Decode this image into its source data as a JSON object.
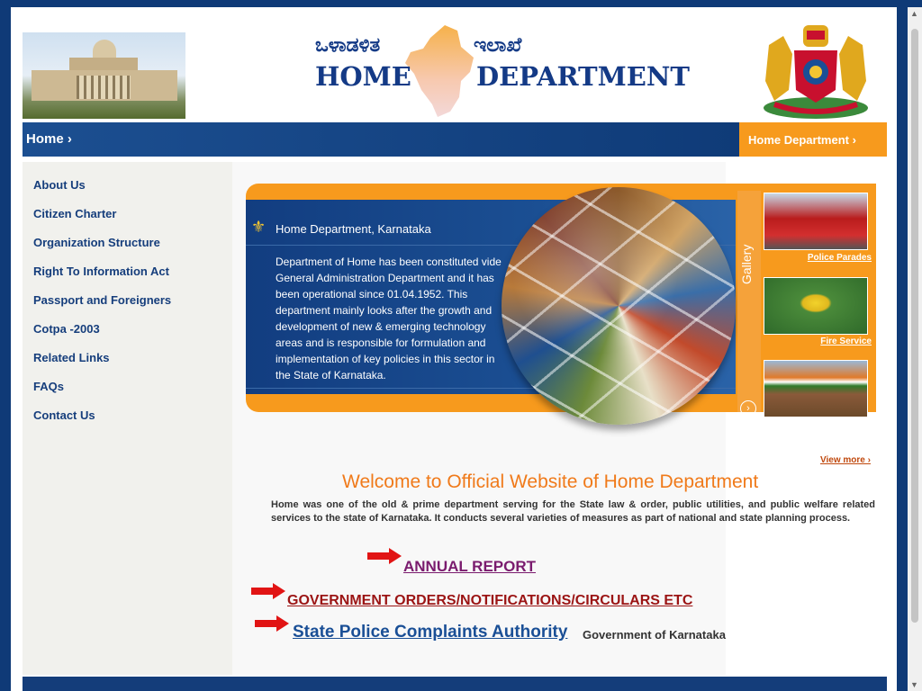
{
  "header": {
    "kannada_left": "ಒಳಾಡಳಿತ",
    "kannada_right": "ಇಲಾಖೆ",
    "title_left": "HOME",
    "title_right": "DEPARTMENT"
  },
  "nav": {
    "home_label": "Home ›",
    "dept_label": "Home Department ›"
  },
  "sidebar": {
    "items": [
      {
        "label": "About Us"
      },
      {
        "label": "Citizen Charter"
      },
      {
        "label": "Organization Structure"
      },
      {
        "label": "Right To Information Act"
      },
      {
        "label": "Passport and Foreigners"
      },
      {
        "label": "Cotpa -2003"
      },
      {
        "label": "Related Links"
      },
      {
        "label": "FAQs"
      },
      {
        "label": "Contact Us"
      }
    ]
  },
  "banner": {
    "title": "Home Department, Karnataka",
    "text": "Department of Home has been constituted vide General Administration Department and it has been operational since 01.04.1952. This department mainly looks after the growth and development of new & emerging technology areas and is responsible for formulation and implementation of key policies in this sector in the State of Karnataka.",
    "gallery_label": "Gallery",
    "gallery_arrow": "›"
  },
  "gallery": {
    "items": [
      {
        "caption": "Police Parades"
      },
      {
        "caption": "Fire Service"
      },
      {
        "caption": ""
      }
    ],
    "view_more": "View more ›"
  },
  "main": {
    "welcome": "Welcome to Official Website of Home Department",
    "intro": "Home was one of the old & prime department serving for the State law & order, public utilities, and public welfare related services to the state of Karnataka. It conducts several varieties of measures as part of national and state planning process.",
    "annual_report": "ANNUAL REPORT",
    "gov_orders": "GOVERNMENT ORDERS/NOTIFICATIONS/CIRCULARS ETC",
    "spca": "State Police Complaints Authority",
    "spca_suffix": "Government of Karnataka"
  },
  "colors": {
    "navy": "#143d7a",
    "orange": "#f79a1d",
    "welcome_orange": "#f07a1a",
    "link_blue": "#163e7c"
  }
}
